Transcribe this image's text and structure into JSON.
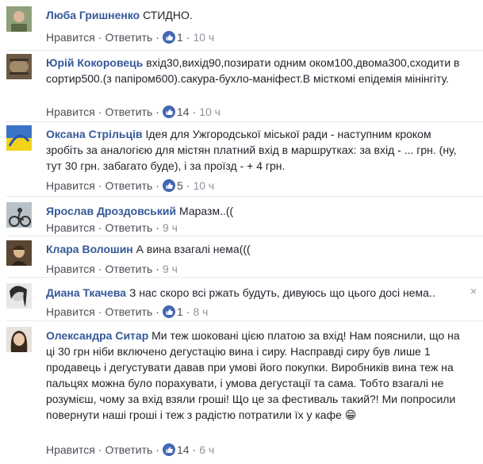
{
  "actions": {
    "like": "Нравится",
    "reply": "Ответить",
    "dot": "·"
  },
  "comments": [
    {
      "author": "Люба Гришненко",
      "text": "СТИДНО.",
      "likes": "1",
      "time": "10 ч"
    },
    {
      "author": "Юрій Кокоровець",
      "text": "вхід30,вихід90,позирати одним оком100,двома300,сходити в сортир500.(з папіром600).сакура-бухло-маніфест.В місткомі епідемія мінінгіту.",
      "likes": "14",
      "time": "10 ч"
    },
    {
      "author": "Оксана Стрільців",
      "text": "Ідея для Ужгородської міської ради - наступним кроком зробіть за аналогією для містян платний вхід в маршрутках: за вхід - ... грн. (ну, тут 30 грн. забагато буде), і за проїзд - + 4 грн.",
      "likes": "5",
      "time": "10 ч"
    },
    {
      "author": "Ярослав Дроздовський",
      "text": "Маразм..((",
      "likes": "",
      "time": "9 ч"
    },
    {
      "author": "Клара Волошин",
      "text": "А вина взагалі нема(((",
      "likes": "",
      "time": "9 ч"
    },
    {
      "author": "Диана Ткачева",
      "text": "З нас скоро всі ржать будуть, дивуюсь що цього досі нема..",
      "likes": "1",
      "time": "8 ч"
    },
    {
      "author": "Олександра Ситар",
      "text": "Ми теж шоковані цією платою за вхід! Нам пояснили, що на ці 30 грн ніби включено дегустацію вина і сиру. Насправді сиру був лише 1 продавець і дегустувати давав при умові його покупки. Виробників вина теж на пальцях можна було порахувати, і умова дегустації та сама. Тобто взагалі не розумієш, чому за вхід взяли гроші! Що це за фестиваль такий?! Ми попросили повернути наші гроші і теж з радістю потратили їх у кафе",
      "likes": "14",
      "time": "6 ч",
      "emoji": "😁"
    }
  ],
  "close_glyph": "×",
  "colors": {
    "name": "#365899",
    "like_blue": "#4267b2",
    "meta": "#4b4f56",
    "time": "#90949c"
  }
}
